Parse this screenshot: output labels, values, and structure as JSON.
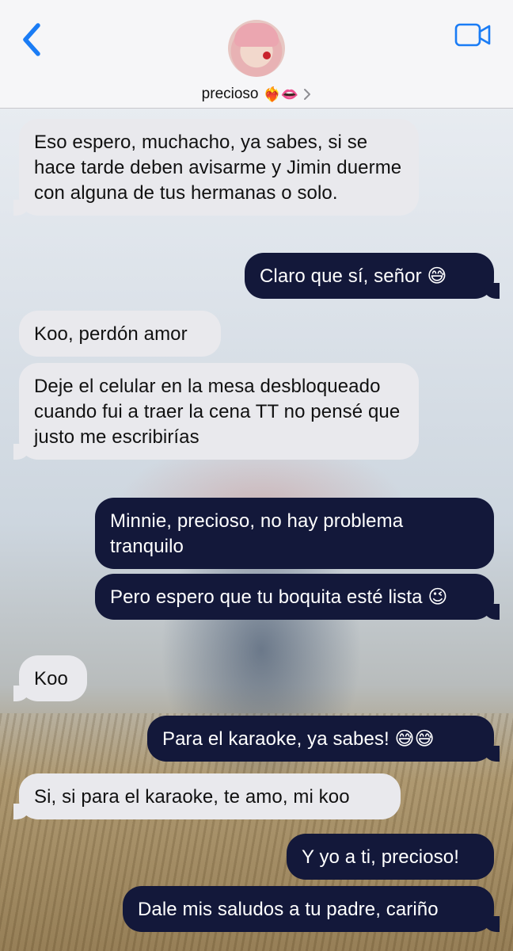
{
  "header": {
    "contact_name": "precioso",
    "contact_emoji": "❤️‍🔥👄"
  },
  "messages": [
    {
      "side": "received",
      "text": "Eso espero, muchacho, ya sabes, si se hace tarde deben avisarme y Jimin duerme con alguna de tus hermanas o solo."
    },
    {
      "side": "sent",
      "text": "Claro que sí, señor 😅"
    },
    {
      "side": "received",
      "text": "Koo, perdón amor"
    },
    {
      "side": "received",
      "text": "Deje el celular en la mesa desbloqueado cuando fui a traer la cena TT no pensé que justo me escribirías"
    },
    {
      "side": "sent",
      "text": "Minnie, precioso, no hay problema tranquilo"
    },
    {
      "side": "sent",
      "text": "Pero espero que tu boquita esté lista 😉"
    },
    {
      "side": "received",
      "text": "Koo"
    },
    {
      "side": "sent",
      "text": "Para el karaoke, ya sabes! 😅😅"
    },
    {
      "side": "received",
      "text": "Si, si para el karaoke, te amo, mi koo"
    },
    {
      "side": "sent",
      "text": "Y yo a ti, precioso!"
    },
    {
      "side": "sent",
      "text": "Dale mis saludos a tu padre, cariño"
    }
  ],
  "colors": {
    "accent": "#1a7cf5",
    "sent_bubble": "#13183a",
    "received_bubble": "#e9e9ed"
  },
  "icons": {
    "back": "chevron-left-icon",
    "video": "video-camera-icon",
    "details": "chevron-right-icon"
  }
}
